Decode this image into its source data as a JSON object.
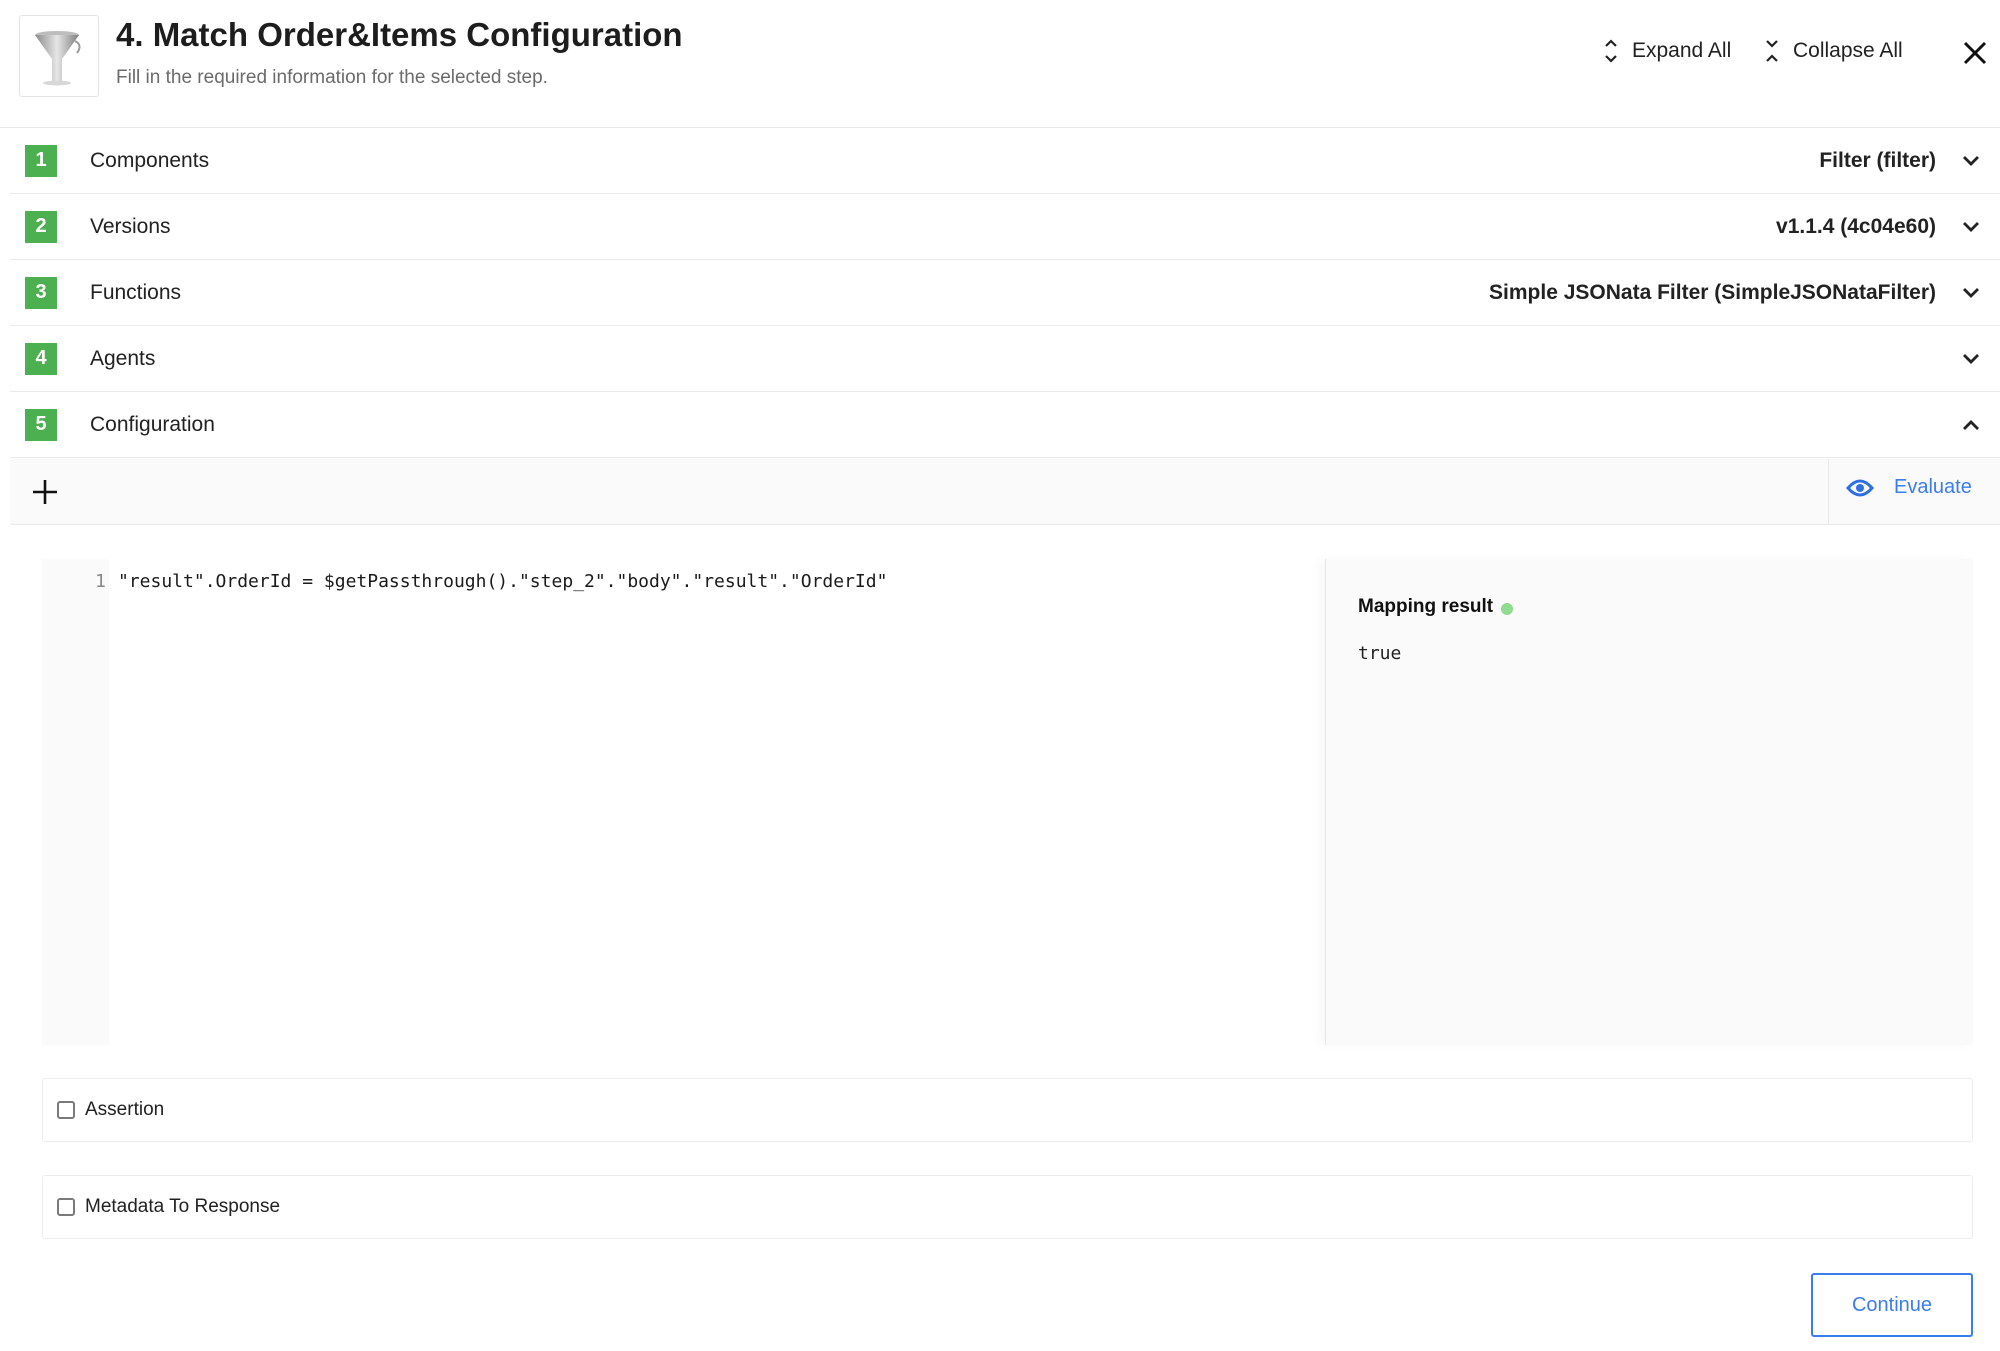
{
  "header": {
    "icon": "funnel-icon",
    "title": "4. Match Order&Items Configuration",
    "subtitle": "Fill in the required information for the selected step.",
    "expand_all_label": "Expand All",
    "collapse_all_label": "Collapse All",
    "close_icon": "close-icon"
  },
  "steps": [
    {
      "number": "1",
      "label": "Components",
      "value": "Filter (filter)",
      "expanded": false
    },
    {
      "number": "2",
      "label": "Versions",
      "value": "v1.1.4 (4c04e60)",
      "expanded": false
    },
    {
      "number": "3",
      "label": "Functions",
      "value": "Simple JSONata Filter (SimpleJSONataFilter)",
      "expanded": false
    },
    {
      "number": "4",
      "label": "Agents",
      "value": "",
      "expanded": false
    },
    {
      "number": "5",
      "label": "Configuration",
      "value": "",
      "expanded": true
    }
  ],
  "toolbar": {
    "add_icon": "plus-icon",
    "evaluate_label": "Evaluate",
    "evaluate_icon": "eye-icon"
  },
  "editor": {
    "lines": [
      {
        "number": "1",
        "code": "\"result\".OrderId = $getPassthrough().\"step_2\".\"body\".\"result\".\"OrderId\""
      }
    ]
  },
  "result": {
    "title": "Mapping result",
    "status": "success",
    "value": "true"
  },
  "options": [
    {
      "label": "Assertion",
      "checked": false
    },
    {
      "label": "Metadata To Response",
      "checked": false
    }
  ],
  "footer": {
    "continue_label": "Continue"
  },
  "colors": {
    "badge": "#4caf50",
    "accent": "#3b7ded",
    "status_dot": "#8fdb8f"
  }
}
